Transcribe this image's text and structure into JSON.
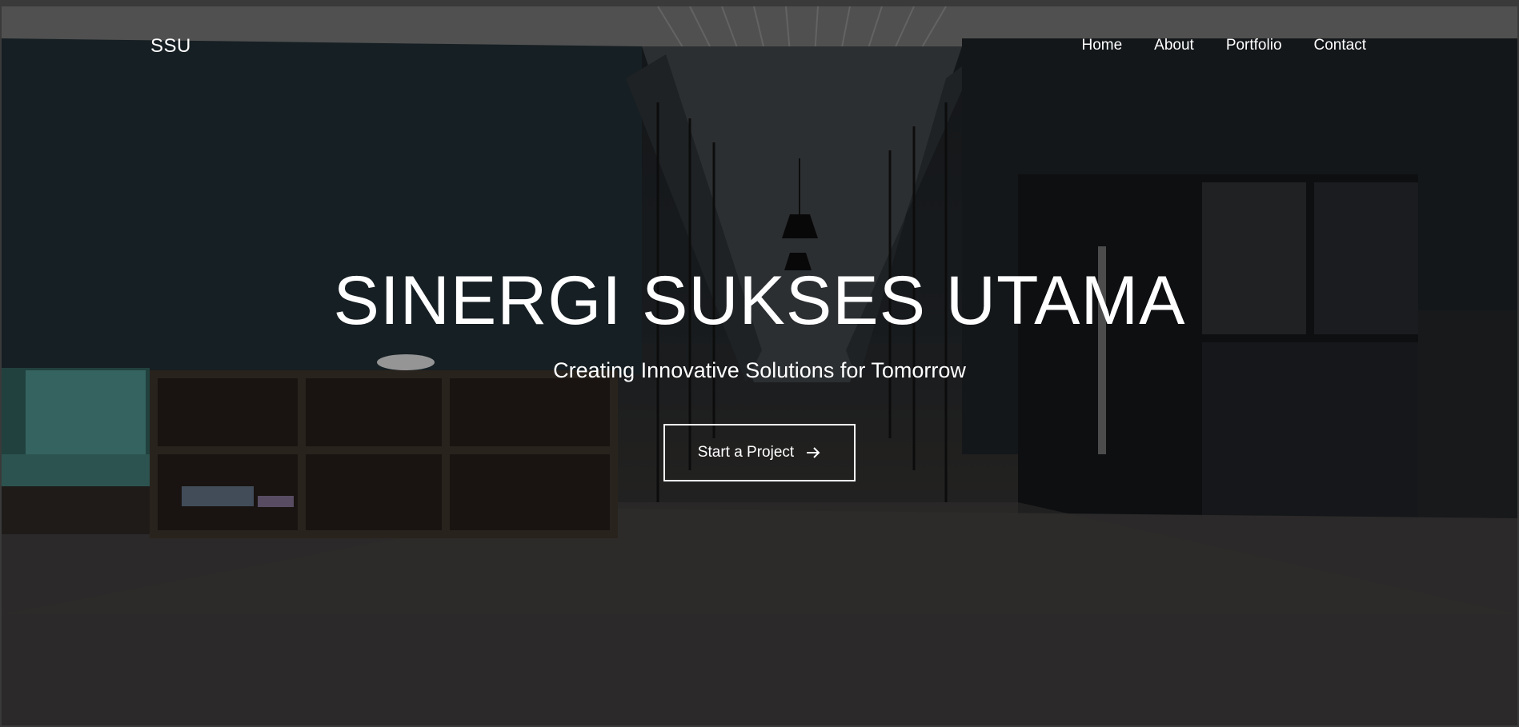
{
  "brand": "SSU",
  "nav": {
    "items": [
      {
        "label": "Home"
      },
      {
        "label": "About"
      },
      {
        "label": "Portfolio"
      },
      {
        "label": "Contact"
      }
    ]
  },
  "hero": {
    "title": "SINERGI SUKSES UTAMA",
    "subtitle": "Creating Innovative Solutions for Tomorrow",
    "cta_label": "Start a Project",
    "cta_icon": "arrow-right-icon",
    "background": "dark office interior photo with teal sofa, wooden shelves, glass corridor and black kitchen cabinets"
  },
  "colors": {
    "text": "#ffffff",
    "wall": "#1e2a30",
    "sofa": "#4a8a84",
    "floor": "#3a3837"
  }
}
